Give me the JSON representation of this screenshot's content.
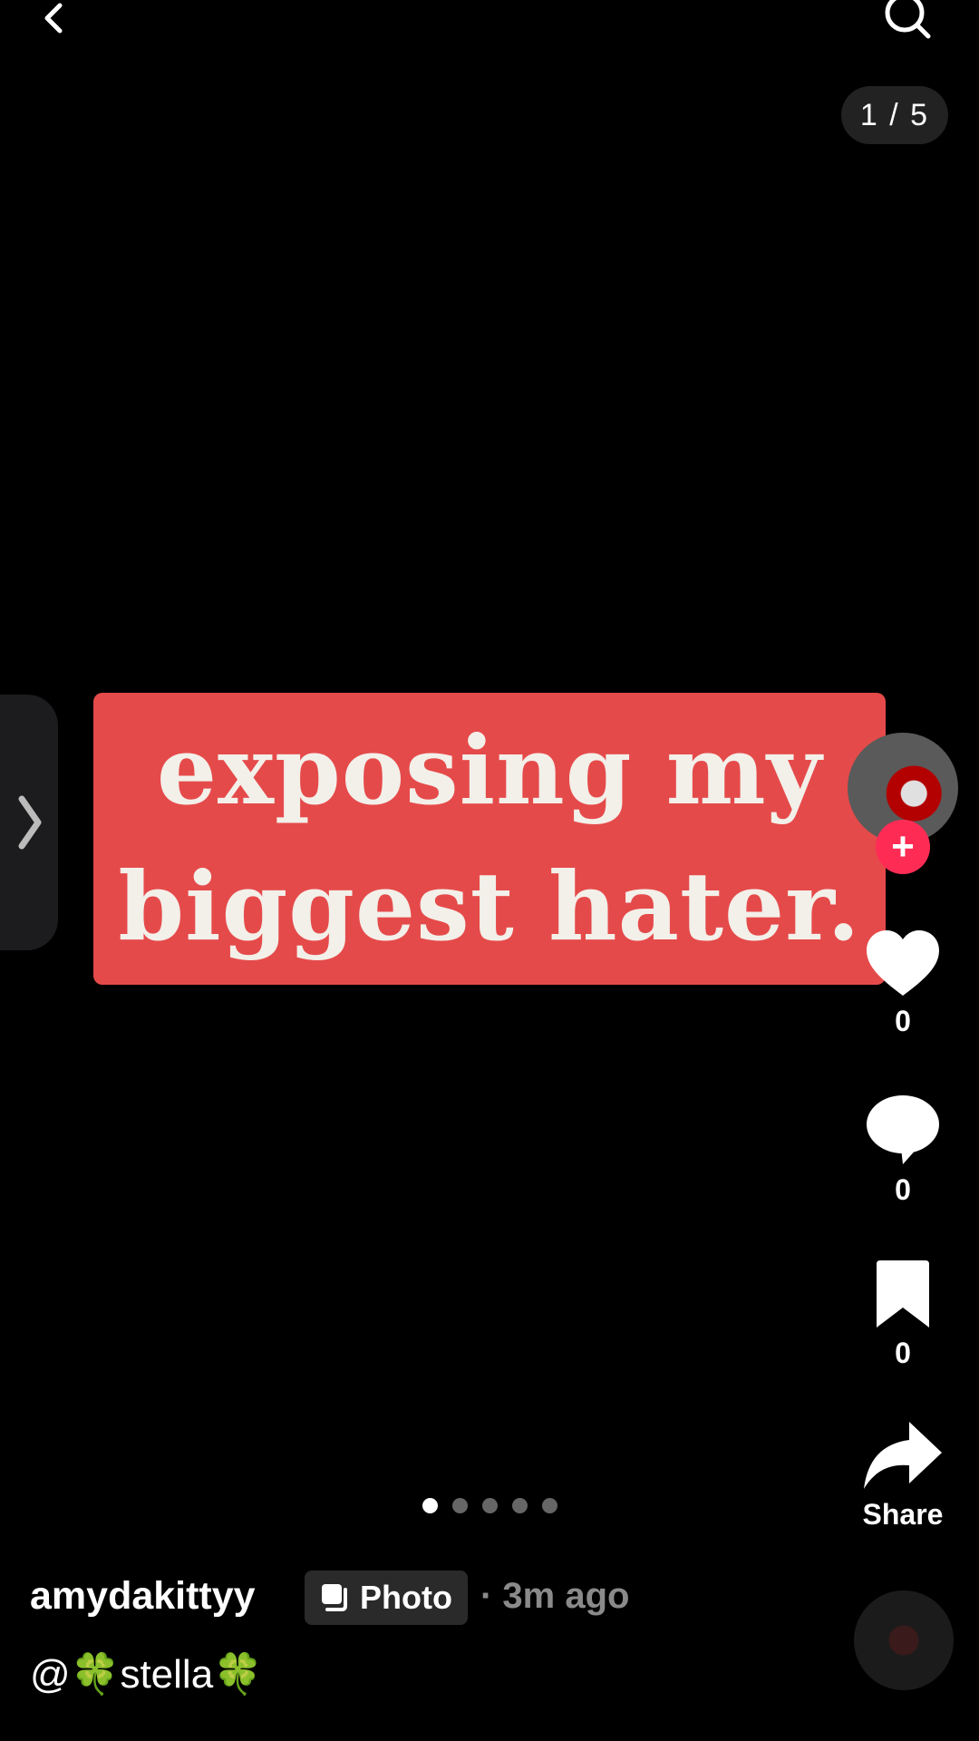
{
  "header": {
    "back_icon": "chevron-left-icon",
    "search_icon": "search-icon",
    "counter": "1 / 5"
  },
  "side_tab": {
    "icon": "chevron-right-icon"
  },
  "banner": {
    "line1": "exposing my",
    "line2": "biggest hater.",
    "color": "#e54a4a"
  },
  "actions": {
    "follow_label": "+",
    "likes": "0",
    "comments": "0",
    "saves": "0",
    "share_label": "Share"
  },
  "pagination": {
    "total": 5,
    "active": 1
  },
  "post": {
    "username": "amydakittyy",
    "type_label": "Photo",
    "time": "· 3m ago",
    "caption": "@🍀stella🍀"
  },
  "colors": {
    "accent": "#fe2c55",
    "background": "#000000"
  }
}
